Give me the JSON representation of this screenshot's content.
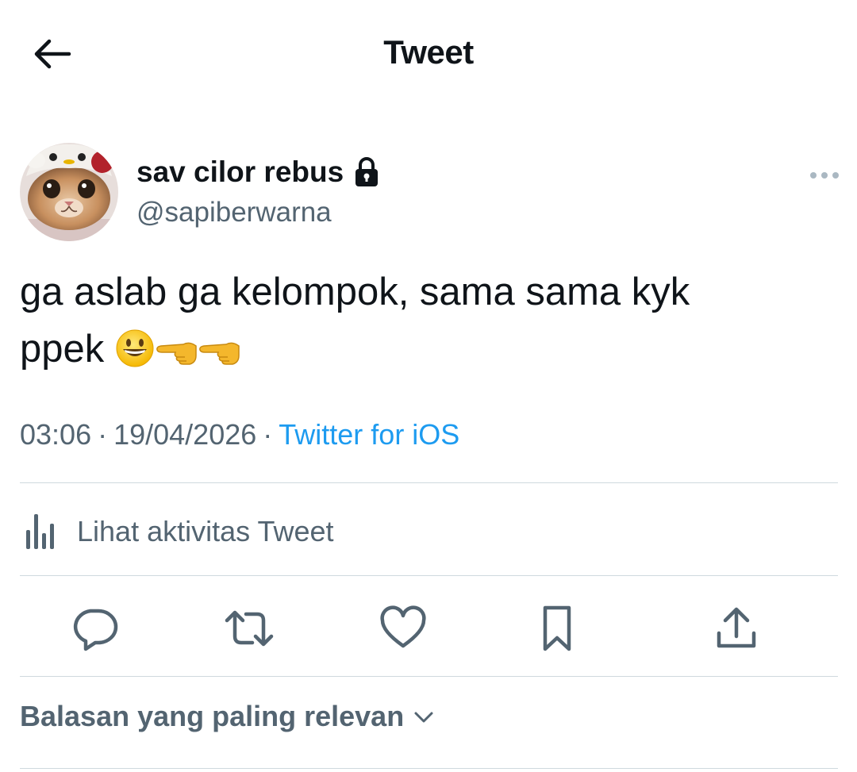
{
  "header": {
    "title": "Tweet",
    "back_icon": "arrow-left-icon"
  },
  "author": {
    "display_name": "sav cilor rebus",
    "username": "@sapiberwarna",
    "protected_icon": "lock-icon",
    "avatar": "cat-in-hat-avatar"
  },
  "tweet": {
    "text_line1": "ga aslab ga kelompok, sama sama kyk",
    "text_line2": "ppek",
    "emojis": [
      "grinning-face-emoji",
      "backhand-pointing-left-emoji",
      "backhand-pointing-left-emoji"
    ]
  },
  "meta": {
    "time": "03:06",
    "separator": "·",
    "date": "19/04/2026",
    "source": "Twitter for iOS"
  },
  "activity": {
    "label": "Lihat aktivitas Tweet",
    "icon": "bar-chart-icon"
  },
  "actions": [
    "reply-icon",
    "retweet-icon",
    "like-icon",
    "bookmark-icon",
    "share-icon"
  ],
  "replies_sort": {
    "label": "Balasan yang paling relevan",
    "icon": "chevron-down-icon"
  },
  "colors": {
    "text": "#0f1419",
    "secondary": "#536471",
    "link": "#1d9bf0",
    "divider": "#cfd9de"
  }
}
